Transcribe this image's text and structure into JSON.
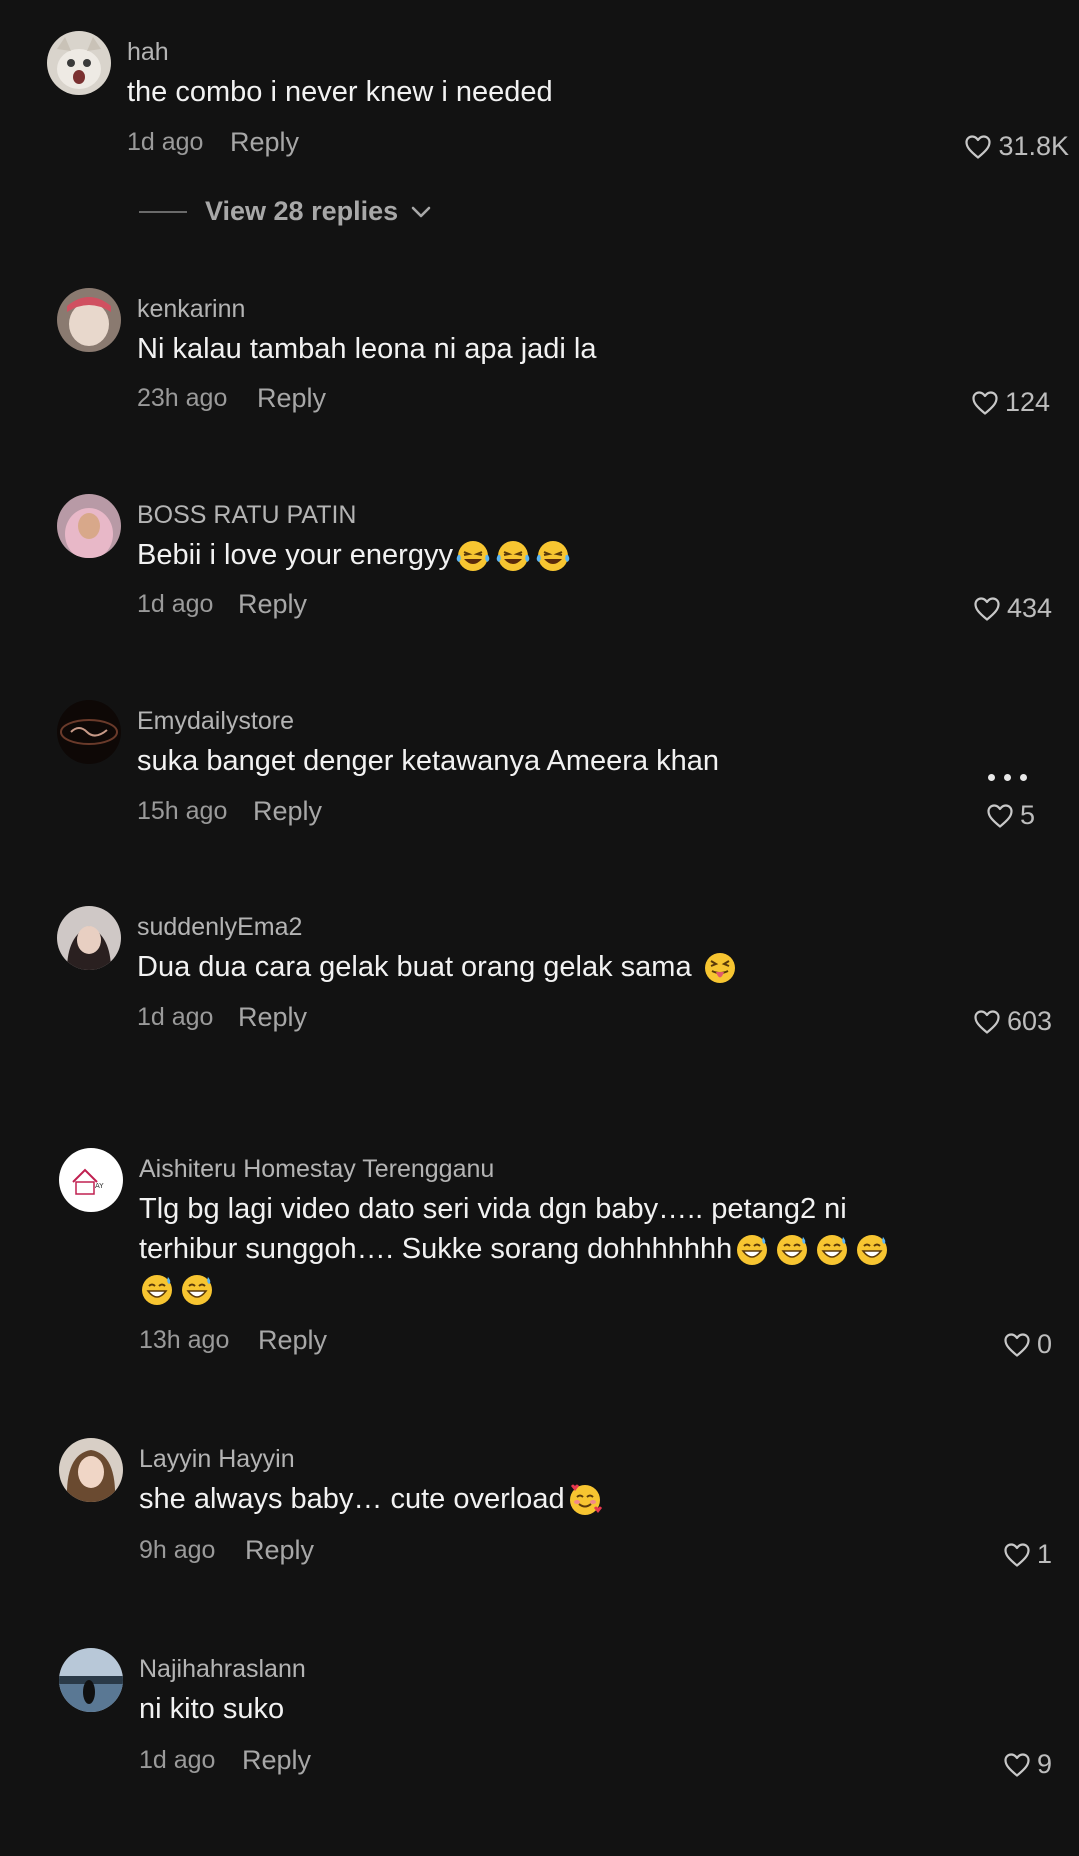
{
  "comments": [
    {
      "username": "hah",
      "text": "the combo i never knew i needed",
      "time": "1d ago",
      "reply_label": "Reply",
      "likes": "31.8K",
      "view_replies": "View 28 replies",
      "avatar": "cat-avatar"
    },
    {
      "username": "kenkarinn",
      "text": "Ni kalau tambah leona ni apa jadi la",
      "time": "23h ago",
      "reply_label": "Reply",
      "likes": "124",
      "avatar": "person-avatar"
    },
    {
      "username": "BOSS RATU PATIN",
      "text": "Bebii i love your energyy",
      "emoji": [
        "tears-of-joy",
        "tears-of-joy",
        "tears-of-joy"
      ],
      "time": "1d ago",
      "reply_label": "Reply",
      "likes": "434",
      "avatar": "hijab-avatar"
    },
    {
      "username": "Emydailystore",
      "text": "suka banget denger ketawanya Ameera khan",
      "time": "15h ago",
      "reply_label": "Reply",
      "likes": "5",
      "avatar": "store-logo-avatar"
    },
    {
      "username": "suddenlyEma2",
      "text": "Dua dua cara gelak buat orang gelak sama ",
      "emoji": [
        "squinting-tongue"
      ],
      "time": "1d ago",
      "reply_label": "Reply",
      "likes": "603",
      "avatar": "person-avatar"
    },
    {
      "username": "Aishiteru Homestay Terengganu",
      "text_line1": "Tlg bg lagi video dato seri vida dgn baby….. petang2 ni",
      "text_line2": "terhibur sunggoh…. Sukke sorang dohhhhhhh",
      "emoji_line2": [
        "grinning-sweat",
        "grinning-sweat",
        "grinning-sweat",
        "grinning-sweat"
      ],
      "emoji_line3": [
        "grinning-sweat",
        "grinning-sweat"
      ],
      "time": "13h ago",
      "reply_label": "Reply",
      "likes": "0",
      "avatar": "homestay-logo-avatar"
    },
    {
      "username": "Layyin Hayyin",
      "text": "she always baby… cute overload",
      "emoji": [
        "smiling-hearts"
      ],
      "time": "9h ago",
      "reply_label": "Reply",
      "likes": "1",
      "avatar": "person-avatar"
    },
    {
      "username": "Najihahraslann",
      "text": "ni kito suko",
      "time": "1d ago",
      "reply_label": "Reply",
      "likes": "9",
      "avatar": "beach-avatar"
    }
  ],
  "colors": {
    "background": "#121212",
    "text": "#f2f2f2",
    "username": "#b4b4b4",
    "meta": "#9a9a9a"
  }
}
